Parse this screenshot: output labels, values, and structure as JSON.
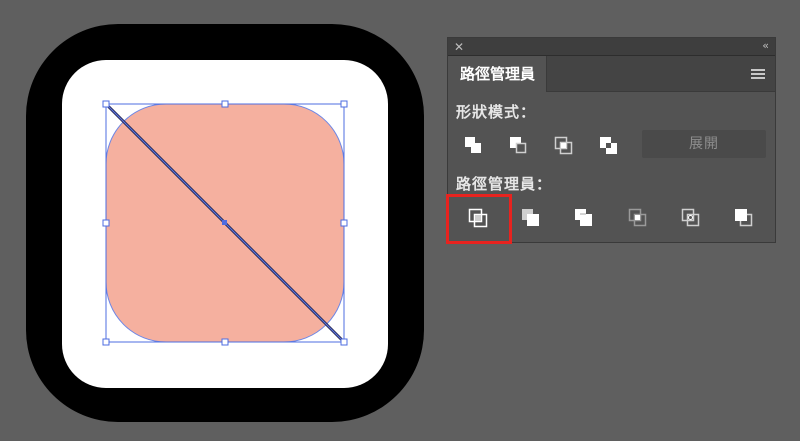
{
  "panel": {
    "close_glyph": "✕",
    "collapse_glyph": "‹‹",
    "tab_label": "路徑管理員",
    "shape_modes_label": "形狀模式：",
    "expand_label": "展開",
    "pathfinders_label": "路徑管理員：",
    "shape_mode_buttons": [
      "unite-icon",
      "minus-front-icon",
      "intersect-icon",
      "exclude-icon"
    ],
    "pathfinder_buttons": [
      "divide-icon",
      "trim-icon",
      "merge-icon",
      "crop-icon",
      "outline-icon",
      "minus-back-icon"
    ],
    "highlighted_button": "divide-icon"
  },
  "colors": {
    "canvas": "#5f5f5f",
    "icon_frame": "#000000",
    "icon_inner": "#ffffff",
    "shape_fill": "#f5b09f",
    "selection": "#4d6ce0",
    "highlight": "#e8231f"
  }
}
